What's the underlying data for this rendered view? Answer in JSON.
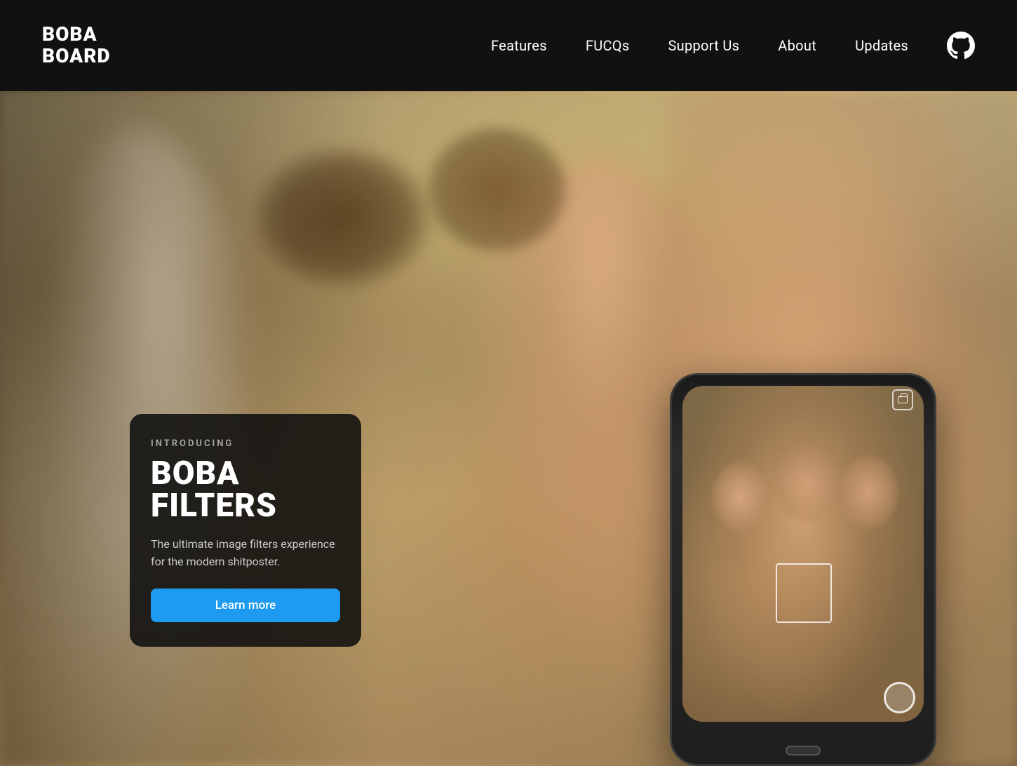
{
  "site": {
    "title": "BobaBoard"
  },
  "navbar": {
    "logo_line1": "BOBA",
    "logo_line2": "BOARD",
    "links": [
      {
        "id": "features",
        "label": "Features"
      },
      {
        "id": "fucqs",
        "label": "FUCQs"
      },
      {
        "id": "support-us",
        "label": "Support Us"
      },
      {
        "id": "about",
        "label": "About"
      },
      {
        "id": "updates",
        "label": "Updates"
      }
    ],
    "github_label": "GitHub"
  },
  "hero": {
    "intro_label": "INTRODUCING",
    "title_line1": "BOBA",
    "title_line2": "FILTERS",
    "description": "The ultimate image filters experience for the modern shitposter.",
    "cta_label": "Learn more"
  }
}
